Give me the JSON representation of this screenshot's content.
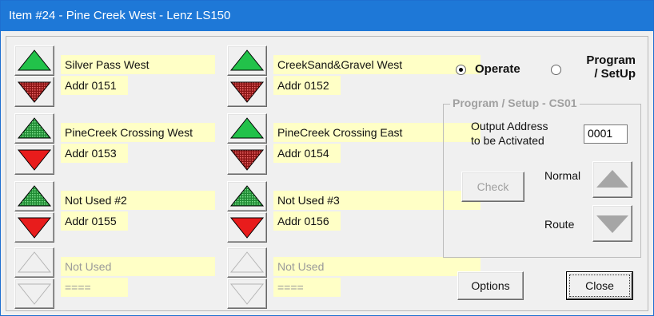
{
  "window": {
    "title": "Item #24 - Pine Creek West - Lenz LS150"
  },
  "turnouts": [
    {
      "name": "Silver Pass West",
      "addr": "Addr 0151",
      "top_style": "solid",
      "bot_style": "dotted"
    },
    {
      "name": "CreekSand&Gravel West",
      "addr": "Addr 0152",
      "top_style": "solid",
      "bot_style": "dotted"
    },
    {
      "name": "PineCreek Crossing West",
      "addr": "Addr 0153",
      "top_style": "dotted",
      "bot_style": "solid"
    },
    {
      "name": "PineCreek Crossing East",
      "addr": "Addr 0154",
      "top_style": "solid",
      "bot_style": "dotted"
    },
    {
      "name": "Not Used #2",
      "addr": "Addr 0155",
      "top_style": "dotted",
      "bot_style": "solid"
    },
    {
      "name": "Not Used #3",
      "addr": "Addr 0156",
      "top_style": "dotted",
      "bot_style": "solid"
    },
    {
      "name": "Not Used",
      "addr": "====",
      "top_style": "disabled",
      "bot_style": "disabled"
    },
    {
      "name": "Not Used",
      "addr": "====",
      "top_style": "disabled",
      "bot_style": "disabled"
    }
  ],
  "mode": {
    "operate_label": "Operate",
    "program_label_line1": "Program",
    "program_label_line2": "/ SetUp",
    "selected": "operate"
  },
  "program_setup": {
    "title": "Program / Setup  -  CS01",
    "output_label_line1": "Output Address",
    "output_label_line2": "to be Activated",
    "output_value": "0001",
    "check_label": "Check",
    "normal_label": "Normal",
    "route_label": "Route"
  },
  "buttons": {
    "options_label": "Options",
    "close_label": "Close"
  },
  "colors": {
    "up_green": "#22c24a",
    "down_red": "#e81c1c",
    "label_bg": "#ffffc6",
    "title_bar": "#1e78d7"
  }
}
